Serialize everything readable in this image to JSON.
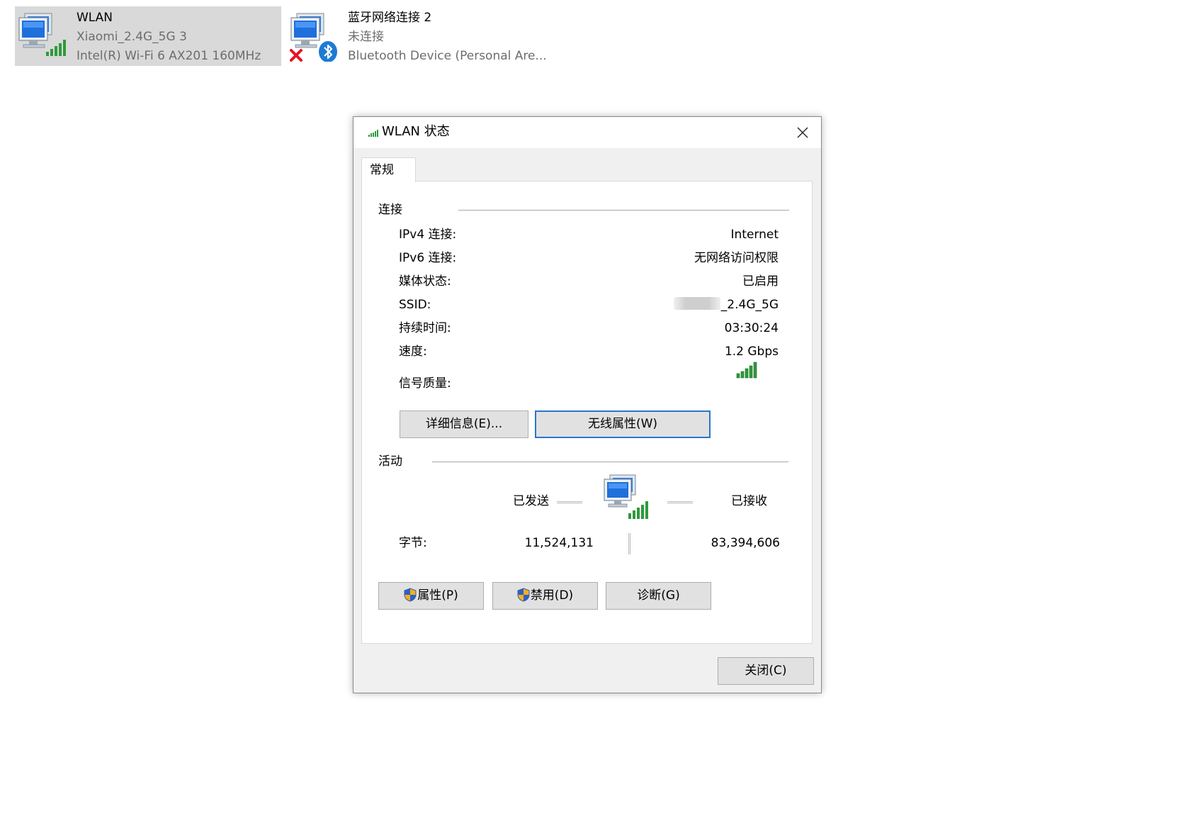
{
  "adapters": [
    {
      "name": "WLAN",
      "network": "Xiaomi_2.4G_5G 3",
      "device": "Intel(R) Wi-Fi 6 AX201 160MHz",
      "icon": "wifi-computer-icon",
      "selected": true
    },
    {
      "name": "蓝牙网络连接 2",
      "network": "未连接",
      "device": "Bluetooth Device (Personal Are...",
      "icon": "bluetooth-computer-icon",
      "status_icon": "disconnected-x-icon"
    }
  ],
  "dialog": {
    "title": "WLAN 状态",
    "close_icon": "close-icon",
    "tab": "常规",
    "connection": {
      "group_label": "连接",
      "rows": [
        {
          "label": "IPv4 连接:",
          "value": "Internet"
        },
        {
          "label": "IPv6 连接:",
          "value": "无网络访问权限"
        },
        {
          "label": "媒体状态:",
          "value": "已启用"
        },
        {
          "label": "SSID:",
          "value": "_2.4G_5G"
        },
        {
          "label": "持续时间:",
          "value": "03:30:24"
        },
        {
          "label": "速度:",
          "value": "1.2 Gbps"
        }
      ],
      "signal_label": "信号质量:",
      "signal_bars": 5,
      "details_button": "详细信息(E)...",
      "wireless_button": "无线属性(W)"
    },
    "activity": {
      "group_label": "活动",
      "sent_label": "已发送",
      "received_label": "已接收",
      "bytes_label": "字节:",
      "bytes_sent": "11,524,131",
      "bytes_received": "83,394,606"
    },
    "buttons": {
      "properties": "属性(P)",
      "disable": "禁用(D)",
      "diagnose": "诊断(G)",
      "close": "关闭(C)"
    },
    "colors": {
      "accent_focus": "#2a76c6",
      "signal_green": "#2e9a3a",
      "disconnected_red": "#e81123",
      "bluetooth_blue": "#1e7ad3"
    }
  }
}
